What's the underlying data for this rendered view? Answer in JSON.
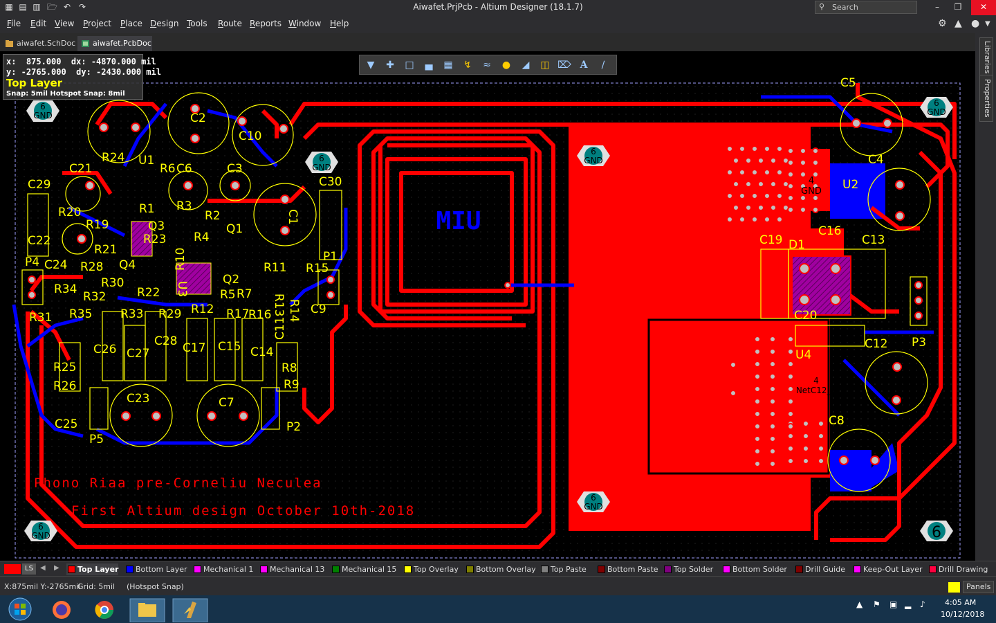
{
  "app": {
    "title": "Aiwafet.PrjPcb - Altium Designer (18.1.7)",
    "search_placeholder": "Search"
  },
  "menu": [
    "File",
    "Edit",
    "View",
    "Project",
    "Place",
    "Design",
    "Tools",
    "Route",
    "Reports",
    "Window",
    "Help"
  ],
  "tabs": [
    {
      "label": "aiwafet.SchDoc",
      "icon": "schematic-doc-icon"
    },
    {
      "label": "aiwafet.PcbDoc",
      "icon": "pcb-doc-icon",
      "active": true
    }
  ],
  "side_panels": [
    "Libraries",
    "Properties"
  ],
  "hud": {
    "line1": "x:  875.000  dx: -4870.000 mil",
    "line2": "y: -2765.000  dy: -2430.000 mil",
    "layer": "Top Layer",
    "snap": "Snap: 5mil Hotspot Snap: 8mil"
  },
  "toolbar_icons": [
    "filter-icon",
    "add-icon",
    "select-rect-icon",
    "chart-icon",
    "component-icon",
    "route-icon",
    "diff-pair-icon",
    "pin-icon",
    "pour-icon",
    "polygon-icon",
    "dimension-icon",
    "text-icon",
    "line-icon"
  ],
  "board": {
    "silk_title": "Phono Riaa pre-Corneliu Neculea",
    "silk_subtitle": "First Altium design October 10th-2018",
    "logo_text": "MIU",
    "designators": [
      "C5",
      "C2",
      "C10",
      "C8",
      "C11",
      "C21",
      "R24",
      "U1",
      "R6",
      "C6",
      "C3",
      "C29",
      "C30",
      "R20",
      "R1",
      "R3",
      "R2",
      "C1",
      "R19",
      "Q3",
      "Q1",
      "R4",
      "C22",
      "R23",
      "R21",
      "P4",
      "C24",
      "R28",
      "Q4",
      "R10",
      "R11",
      "R15",
      "P1",
      "R34",
      "R30",
      "U3",
      "Q2",
      "R13",
      "R32",
      "R22",
      "R5",
      "R7",
      "R16",
      "R14",
      "C9",
      "R31",
      "R35",
      "R33",
      "R29",
      "R12",
      "R17",
      "C11",
      "C26",
      "C27",
      "C28",
      "C17",
      "C15",
      "C14",
      "R25",
      "R8",
      "R26",
      "R9",
      "C23",
      "C7",
      "C25",
      "P5",
      "P2",
      "C4",
      "U2",
      "C16",
      "C19",
      "C13",
      "D1",
      "C20",
      "C12",
      "P3",
      "U4",
      "C8"
    ],
    "net_labels": [
      {
        "num": "6",
        "net": "GND"
      },
      {
        "num": "4",
        "net": "GND"
      },
      {
        "num": "4",
        "net": "NetC12_2"
      }
    ]
  },
  "layers": [
    {
      "name": "Top Layer",
      "color": "#ff0000",
      "active": true
    },
    {
      "name": "Bottom Layer",
      "color": "#0000ff"
    },
    {
      "name": "Mechanical 1",
      "color": "#ff00ff"
    },
    {
      "name": "Mechanical 13",
      "color": "#ff00ff"
    },
    {
      "name": "Mechanical 15",
      "color": "#008000"
    },
    {
      "name": "Top Overlay",
      "color": "#ffff00"
    },
    {
      "name": "Bottom Overlay",
      "color": "#808000"
    },
    {
      "name": "Top Paste",
      "color": "#808080"
    },
    {
      "name": "Bottom Paste",
      "color": "#800000"
    },
    {
      "name": "Top Solder",
      "color": "#800080"
    },
    {
      "name": "Bottom Solder",
      "color": "#ff00ff"
    },
    {
      "name": "Drill Guide",
      "color": "#800000"
    },
    {
      "name": "Keep-Out Layer",
      "color": "#ff00ff"
    },
    {
      "name": "Drill Drawing",
      "color": "#ff0040"
    }
  ],
  "layer_set_label": "LS",
  "status": {
    "coords": "X:875mil Y:-2765mil",
    "grid": "Grid: 5mil",
    "snap": "(Hotspot Snap)",
    "panels": "Panels"
  },
  "tray": {
    "time": "4:05 AM",
    "date": "10/12/2018"
  }
}
